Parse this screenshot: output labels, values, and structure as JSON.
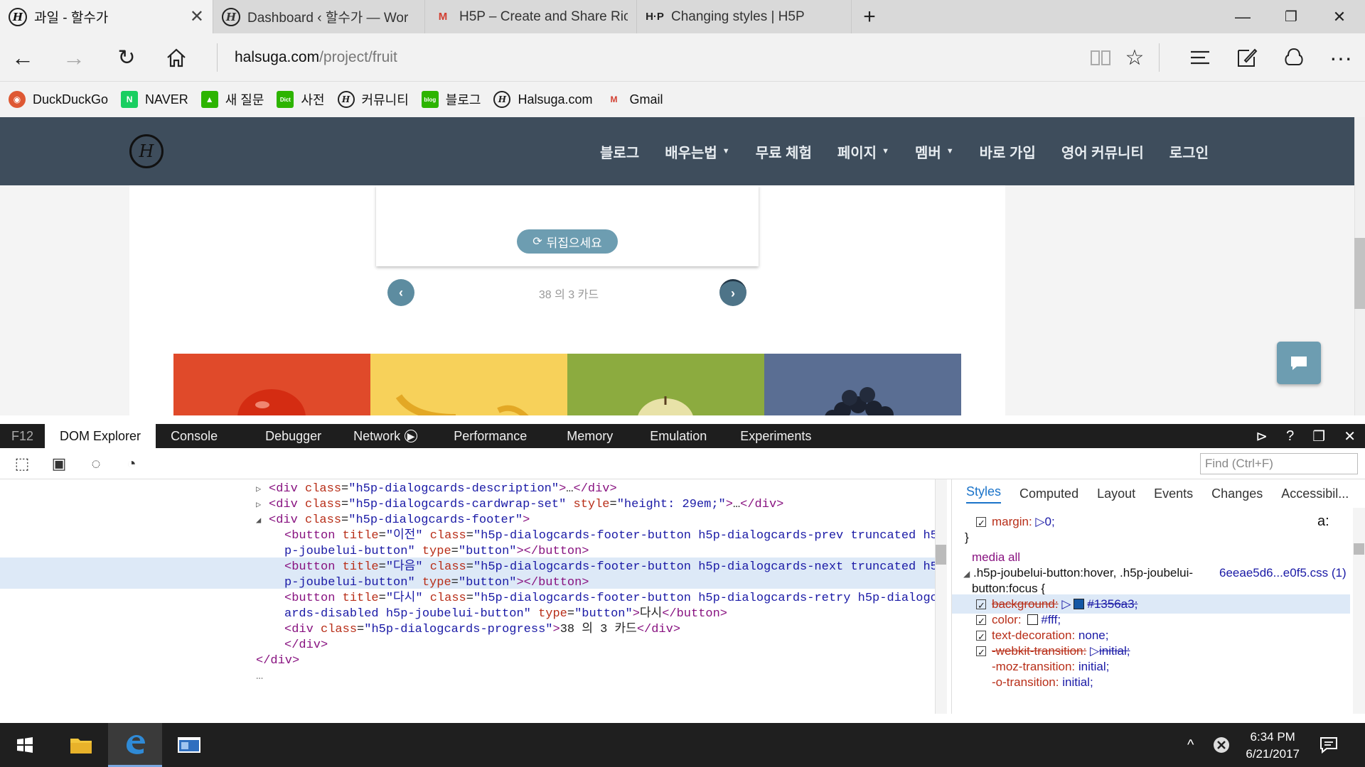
{
  "tabs": [
    {
      "title": "과일 - 할수가",
      "icon": "halsuga-logo-icon"
    },
    {
      "title": "Dashboard ‹ 할수가 — Wor",
      "icon": "halsuga-logo-icon"
    },
    {
      "title": "H5P – Create and Share Ric",
      "icon": "gmail-icon"
    },
    {
      "title": "Changing styles | H5P",
      "icon": "h5p-icon"
    }
  ],
  "tab_icons": {
    "h5p": "H·P",
    "gmail": "M",
    "halsuga": "H"
  },
  "address": {
    "domain": "halsuga.com",
    "path": "/project/fruit"
  },
  "favorites": [
    {
      "label": "DuckDuckGo",
      "icon": "duckduckgo-icon",
      "color": "#de5833"
    },
    {
      "label": "NAVER",
      "icon": "naver-icon",
      "color": "#19ce60",
      "glyph": "N"
    },
    {
      "label": "새 질문",
      "icon": "graduation-cap-icon",
      "color": "#2db400",
      "glyph": "🎓"
    },
    {
      "label": "사전",
      "icon": "dictionary-icon",
      "color": "#2db400",
      "glyph": "Dict"
    },
    {
      "label": "커뮤니티",
      "icon": "halsuga-logo-icon",
      "color": "#222222",
      "glyph": "H"
    },
    {
      "label": "블로그",
      "icon": "blog-icon",
      "color": "#2db400",
      "glyph": "blog"
    },
    {
      "label": "Halsuga.com",
      "icon": "halsuga-logo-icon",
      "color": "#222222",
      "glyph": "H"
    },
    {
      "label": "Gmail",
      "icon": "gmail-icon",
      "color": "#d23f31",
      "glyph": "M"
    }
  ],
  "site": {
    "logo": "H",
    "nav": [
      {
        "label": "블로그",
        "dropdown": false
      },
      {
        "label": "배우는법",
        "dropdown": true
      },
      {
        "label": "무료 체험",
        "dropdown": false
      },
      {
        "label": "페이지",
        "dropdown": true
      },
      {
        "label": "멤버",
        "dropdown": true
      },
      {
        "label": "바로 가입",
        "dropdown": false
      },
      {
        "label": "영어 커뮤니티",
        "dropdown": false
      },
      {
        "label": "로그인",
        "dropdown": false
      }
    ],
    "flip_label": "뒤집으세요",
    "progress": "38 의 3 카드",
    "header_color": "#3e4d5c",
    "accent_color": "#6d9db1",
    "fruit_colors": [
      "#e04a2a",
      "#f7d15a",
      "#8cab3f",
      "#5a6e93"
    ]
  },
  "devtools": {
    "f12": "F12",
    "tabs": [
      "DOM Explorer",
      "Console",
      "Debugger",
      "Network",
      "Performance",
      "Memory",
      "Emulation",
      "Experiments"
    ],
    "find_placeholder": "Find (Ctrl+F)",
    "style_tabs": [
      "Styles",
      "Computed",
      "Layout",
      "Events",
      "Changes",
      "Accessibil..."
    ],
    "css": {
      "margin_prop": "margin:",
      "margin_val": "0;",
      "close_brace": "}",
      "media": "media all",
      "selector": ".h5p-joubelui-button:hover, .h5p-joubelui-",
      "selector2": "button:focus  {",
      "source": "6eeae5d6...e0f5.css (1)",
      "bg_prop": "background:",
      "bg_val": "#1356a3;",
      "bg_color": "#1356a3",
      "color_prop": "color:",
      "color_val": "#fff;",
      "td_prop": "text-decoration:",
      "td_val": "none;",
      "wt_prop": "-webkit-transition:",
      "wt_val": "initial;",
      "mt_prop": "-moz-transition:",
      "mt_val": "initial;",
      "ot_prop": "-o-transition:",
      "ot_val": "initial;"
    },
    "dom": {
      "desc_class": "h5p-dialogcards-description",
      "cardwrap_class": "h5p-dialogcards-cardwrap-set",
      "cardwrap_style": "height: 29em;",
      "footer_class": "h5p-dialogcards-footer",
      "prev_title": "이전",
      "prev_class1": "h5p-dialogcards-footer-button h5p-dialogcards-prev truncated h5",
      "prev_class2": "p-joubelui-button",
      "next_title": "다음",
      "next_class1": "h5p-dialogcards-footer-button h5p-dialogcards-next truncated h5",
      "next_class2": "p-joubelui-button",
      "retry_title": "다시",
      "retry_class1": "h5p-dialogcards-footer-button h5p-dialogcards-retry h5p-dialogc",
      "retry_class2": "ards-disabled h5p-joubelui-button",
      "retry_text": "다시",
      "button_type": "button",
      "progress_class": "h5p-dialogcards-progress",
      "progress_text": "38 의 3 카드"
    }
  },
  "taskbar": {
    "time": "6:34 PM",
    "date": "6/21/2017"
  }
}
